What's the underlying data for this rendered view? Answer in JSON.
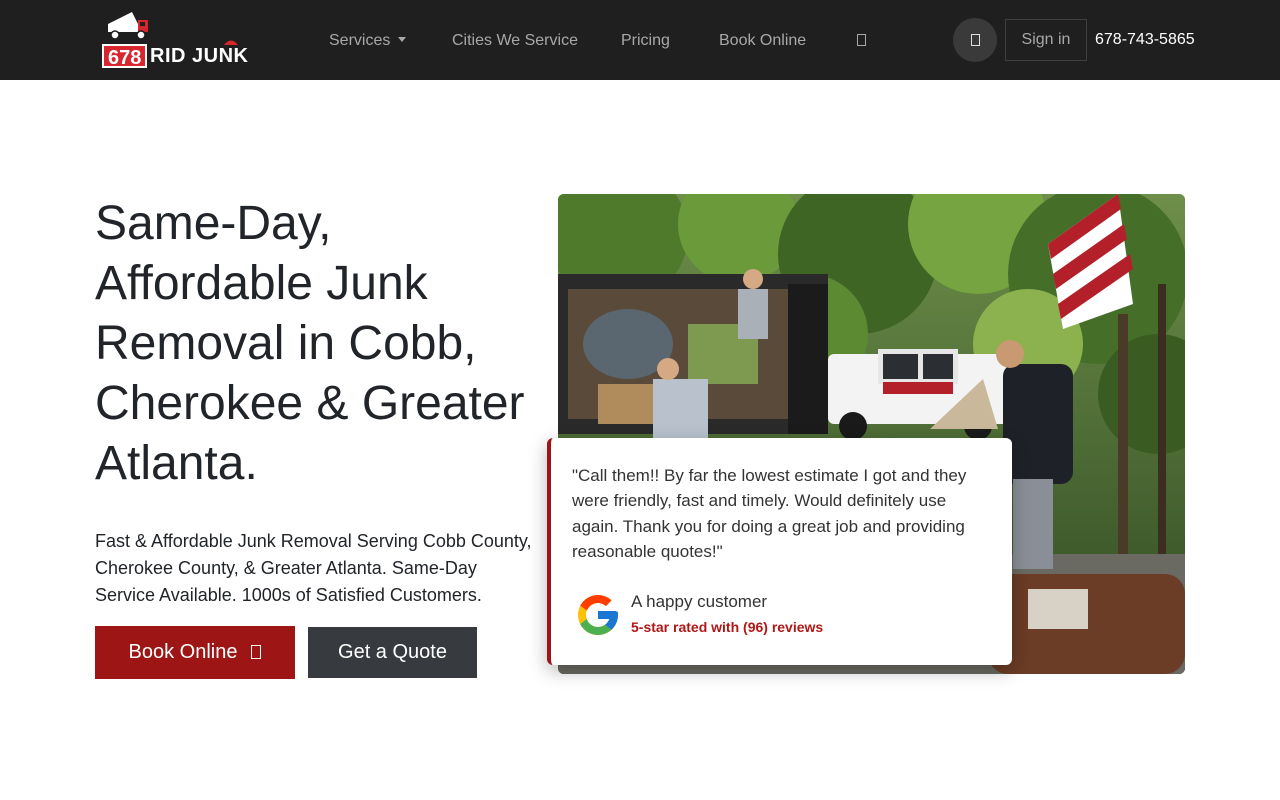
{
  "brand": {
    "number": "678",
    "name": "RID JUNK",
    "accent_color": "#9d1515",
    "logo_red": "#d7262e"
  },
  "nav": {
    "items": [
      {
        "label": "Services",
        "has_dropdown": true
      },
      {
        "label": "Cities We Service"
      },
      {
        "label": "Pricing"
      },
      {
        "label": "Book Online"
      }
    ],
    "icon": "square-icon",
    "circle_button_icon": "square-icon",
    "signin_label": "Sign in",
    "phone": "678-743-5865"
  },
  "hero": {
    "title": "Same-Day, Affordable Junk Removal in Cobb, Cherokee & Greater Atlanta.",
    "subtitle": "Fast & Affordable Junk Removal Serving Cobb County, Cherokee County, & Greater Atlanta. Same-Day Service Available. 1000s of Satisfied Customers.",
    "book_button": "Book Online",
    "book_button_icon": "square-icon",
    "quote_button": "Get a Quote"
  },
  "review": {
    "quote": "\"Call them!! By far the lowest estimate I got and they were friendly, fast and timely. Would definitely use again. Thank you for doing a great job and providing reasonable quotes!\"",
    "reviewer": "A happy customer",
    "rating_text": "5-star rated with (96) reviews",
    "source_icon": "google-icon"
  }
}
